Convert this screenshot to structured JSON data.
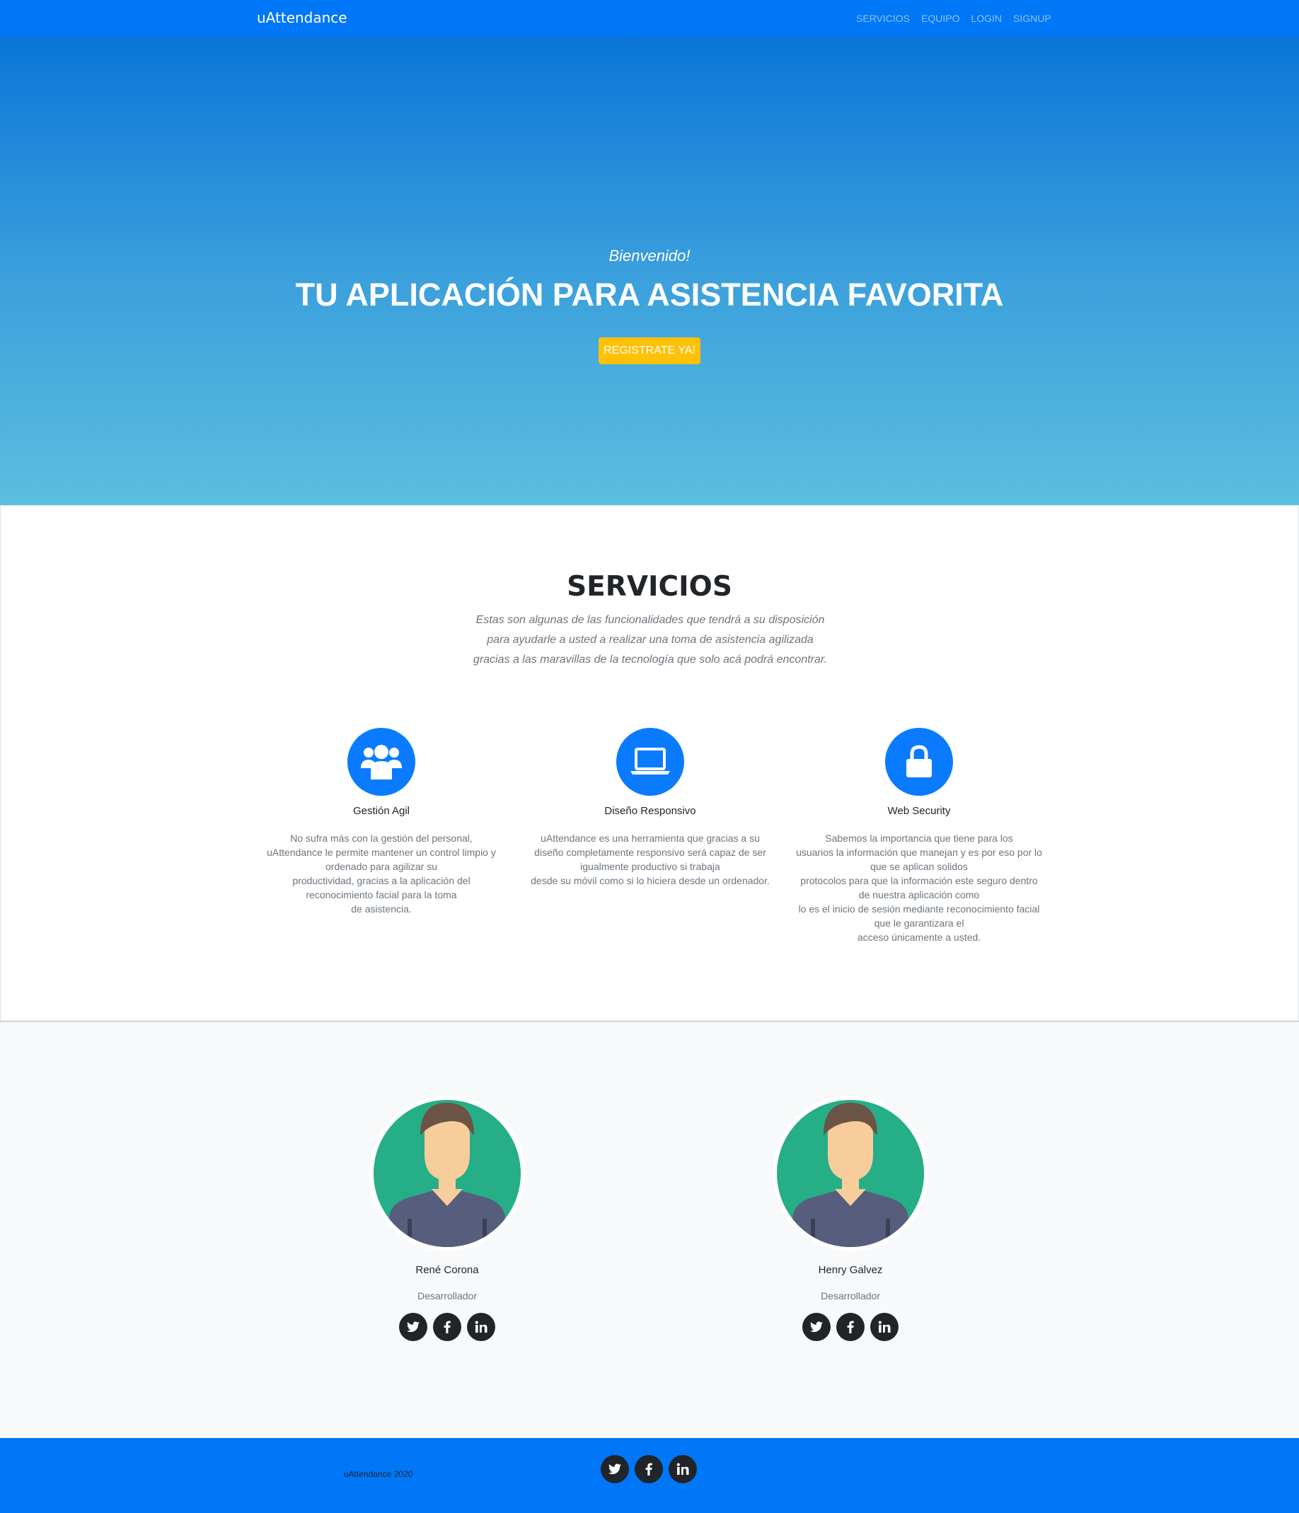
{
  "navbar": {
    "brand": "uAttendance",
    "links": [
      "SERVICIOS",
      "EQUIPO",
      "LOGIN",
      "SIGNUP"
    ]
  },
  "hero": {
    "welcome": "Bienvenido!",
    "title": "TU APLICACIÓN PARA ASISTENCIA FAVORITA",
    "cta": "REGISTRATE YA!"
  },
  "services": {
    "title": "SERVICIOS",
    "subtitle": "Estas son algunas de las funcionalidades que tendrá a su disposición\npara ayudarle a usted a realizar una toma de asistencia agilizada\ngracias a las maravillas de la tecnología que solo acá podrá encontrar.",
    "items": [
      {
        "icon": "users-icon",
        "name": "Gestión Agil",
        "text": "No sufra más con la gestión del personal,\nuAttendance le permite mantener un control limpio y\nordenado para agilizar su\nproductividad, gracias a la aplicación del\nreconocimiento facial para la toma\nde asistencia."
      },
      {
        "icon": "laptop-icon",
        "name": "Diseño Responsivo",
        "text": "uAttendance es una herramienta que gracias a su\ndiseño completamente responsivo será capaz de ser\nigualmente productivo si trabaja\ndesde su móvil como si lo hiciera desde un ordenador."
      },
      {
        "icon": "lock-icon",
        "name": "Web Security",
        "text": "Sabemos la importancia que tiene para los\nusuarios la información que manejan y es por eso por lo\nque se aplican solidos\nprotocolos para que la información este seguro dentro\nde nuestra aplicación como\nlo es el inicio de sesión mediante reconocimiento facial\nque le garantizara el\nacceso únicamente a usted."
      }
    ]
  },
  "team": {
    "members": [
      {
        "name": "René Corona",
        "role": "Desarrollador"
      },
      {
        "name": "Henry Galvez",
        "role": "Desarrollador"
      }
    ]
  },
  "footer": {
    "copyright": "uAttendance 2020"
  },
  "colors": {
    "primary": "#0077f7",
    "accent": "#ffc107",
    "avatar_bg": "#26ae87"
  }
}
